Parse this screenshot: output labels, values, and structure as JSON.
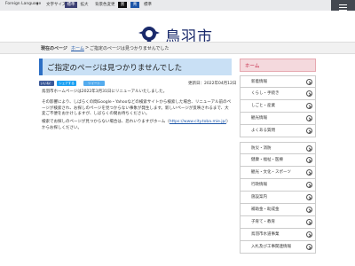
{
  "topbar": {
    "language": "Foreign Language",
    "text_size_label": "文字サイズ",
    "text_size_standard": "標準",
    "text_size_large": "拡大",
    "bg_color_label": "背景色変更",
    "bg_black": "黒",
    "bg_blue": "青",
    "bg_standard": "標準"
  },
  "menu": {
    "label": "MENU"
  },
  "header": {
    "site_title": "鳥羽市"
  },
  "breadcrumb": {
    "title": "現在のページ",
    "home": "ホーム",
    "separator": ">",
    "current": "ご指定のページは見つかりませんでした"
  },
  "page": {
    "heading": "ご指定のページは見つかりませんでした",
    "share": [
      "いいね！",
      "シェアする",
      "ツイート"
    ],
    "updated": "更新日：2022年04月12日",
    "paragraph1": "鳥羽市ホームページは2022年3月31日にリニューアルいたしました。",
    "paragraph2": "その影響により、しばらくの間Google・Yahooなどの検索サイトから検索した場合、リニューアル前のページが検索され、お探しのページを見つからない事象が発生します。新しいページが反映されるまで、大変ご不便をおかけしますが、しばらくの間お待ちください。",
    "paragraph3_prefix": "検索でお探しのページが見つからない場合は、恐れいりますがホーム（",
    "paragraph3_link": "https://www.city.toba.mie.jp/",
    "paragraph3_suffix": "）からお探しください。"
  },
  "sidebar": {
    "heading": "ホーム",
    "group1": [
      "新着情報",
      "くらし・手続き",
      "しごと・産業",
      "観光情報",
      "よくある質問"
    ],
    "group2": [
      "防災・消防",
      "健康・福祉・医療",
      "観光・文化・スポーツ",
      "行政情報",
      "施設案内",
      "補助金・助成金",
      "子育て・教育",
      "鳥羽市水道事業",
      "入札及び工事関連情報"
    ]
  },
  "colors": {
    "accent": "#1d56a8",
    "heading_bg": "#c9e0f5",
    "sidebar_head": "#c2183a",
    "title": "#1a2a6b"
  }
}
